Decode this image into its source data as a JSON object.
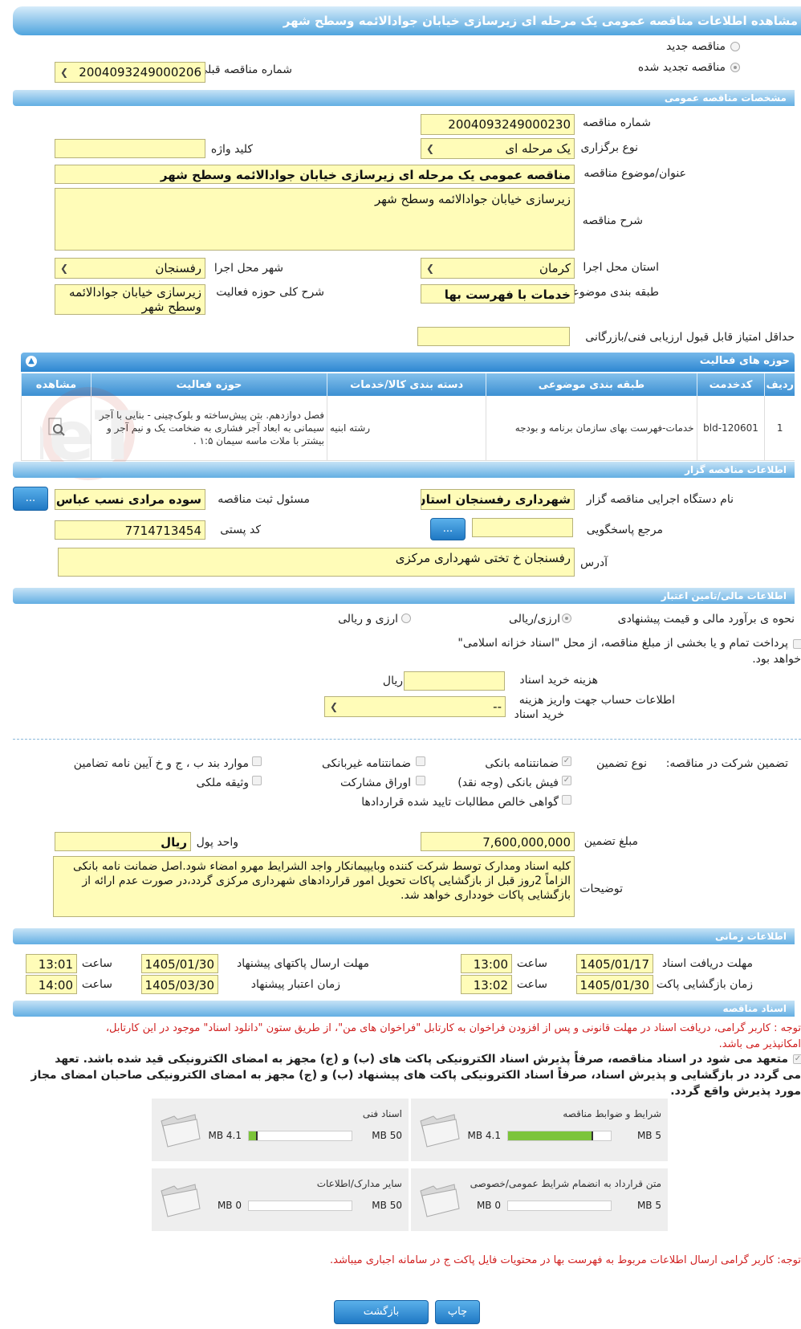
{
  "title": "مشاهده اطلاعات مناقصه عمومی یک مرحله ای زیرسازی خیابان جوادالائمه وسطح شهر",
  "tender_type": {
    "new_label": "مناقصه جدید",
    "renewed_label": "مناقصه تجدید شده",
    "prev_number_label": "شماره مناقصه قبلی",
    "prev_number": "2004093249000206"
  },
  "general": {
    "section_title": "مشخصات مناقصه عمومی",
    "number_label": "شماره مناقصه",
    "number": "2004093249000230",
    "type_label": "نوع برگزاری",
    "type": "یک مرحله ای",
    "keyword_label": "کلید واژه",
    "keyword": "",
    "subject_label": "عنوان/موضوع مناقصه",
    "subject": "مناقصه عمومی یک مرحله ای زیرسازی خیابان جوادالائمه وسطح شهر",
    "desc_label": "شرح مناقصه",
    "desc": "زیرسازی خیابان جوادالائمه وسطح شهر",
    "province_label": "استان محل اجرا",
    "province": "کرمان",
    "city_label": "شهر محل اجرا",
    "city": "رفسنجان",
    "category_label": "طبقه بندی موضوعی",
    "category": "خدمات با فهرست بها",
    "scope_label": "شرح کلی حوزه فعالیت",
    "scope": "زیرسازی خیابان جوادالائمه وسطح شهر",
    "min_score_label": "حداقل امتیاز قابل قبول ارزیابی فنی/بازرگانی",
    "min_score": ""
  },
  "activity": {
    "section_title": "حوزه های فعالیت",
    "headers": [
      "ردیف",
      "کدخدمت",
      "طبقه بندی موضوعی",
      "دسته بندی کالا/خدمات",
      "حوزه فعالیت",
      "مشاهده"
    ],
    "row": {
      "idx": "1",
      "code": "bld-120601",
      "class": "خدمات-فهرست بهای سازمان برنامه و بودجه",
      "group": "رشته ابنیه",
      "scope": "فصل دوازدهم. بتن پیش‌ساخته و بلوک‌چینی - بنایی با آجر سیمانی به ابعاد آجر فشاری به ضخامت یک و نیم آجر و بیشتر با ملات ماسه سیمان ۱:۵ ."
    }
  },
  "organizer": {
    "section_title": "اطلاعات مناقصه گزار",
    "org_label": "نام دستگاه اجرایی مناقصه گزار",
    "org": "شهرداری رفسنجان استان",
    "resp_label": "مسئول ثبت مناقصه",
    "resp": "سوده مرادی نسب عباس آباد",
    "ref_label": "مرجع پاسخگویی",
    "ref": "",
    "zip_label": "کد پستی",
    "zip": "7714713454",
    "addr_label": "آدرس",
    "addr": "رفسنجان خ تختی شهرداری مرکزی",
    "btn_more": "..."
  },
  "finance": {
    "section_title": "اطلاعات مالی/تامین اعتبار",
    "method_label": "نحوه ی برآورد مالی و قیمت پیشنهادی",
    "opt1": "ارزی/ریالی",
    "opt2": "ارزی و ریالی",
    "treasury_line1": "پرداخت تمام و یا بخشی از مبلغ مناقصه، از محل \"اسناد خزانه اسلامی\"",
    "treasury_line2": "خواهد بود.",
    "doc_cost_label": "هزینه خرید اسناد",
    "doc_cost": "",
    "currency": "ریال",
    "account_label1": "اطلاعات حساب جهت واریز هزینه",
    "account_label2": "خرید اسناد",
    "account": "--"
  },
  "guarantee": {
    "title": "تضمین شرکت در مناقصه:",
    "type_label": "نوع تضمین",
    "opts": [
      "ضمانتنامه بانکی",
      "ضمانتنامه غیربانکی",
      "موارد بند ب ، ج و خ آیین نامه تضامین",
      "فیش بانکی (وجه نقد)",
      "اوراق مشارکت",
      "وثیقه ملکی",
      "گواهی خالص مطالبات تایید شده قراردادها"
    ],
    "amount_label": "مبلغ تضمین",
    "amount": "7,600,000,000",
    "unit_label": "واحد پول",
    "unit": "ریال",
    "notes_label": "توضیحات",
    "notes": "کلیه اسناد ومدارک توسط شرکت کننده وبایپیمانکار واجد الشرایط مهرو امضاء شود.اصل ضمانت نامه بانکی الزاماً 2روز قبل از بازگشایی پاکات تحویل امور قراردادهای شهرداری مرکزی گردد،در صورت عدم ارائه از بازگشایی پاکات خودداری خواهد شد."
  },
  "times": {
    "section_title": "اطلاعات زمانی",
    "recv_label": "مهلت دریافت اسناد",
    "recv_date": "1405/01/17",
    "recv_time": "13:00",
    "send_label": "مهلت ارسال پاکتهای پیشنهاد",
    "send_date": "1405/01/30",
    "send_time": "13:01",
    "open_label": "زمان بازگشایی پاکت ها",
    "open_date": "1405/01/30",
    "open_time": "13:02",
    "valid_label": "زمان اعتبار پیشنهاد",
    "valid_date": "1405/03/30",
    "valid_time": "14:00",
    "time_label": "ساعت"
  },
  "docs": {
    "section_title": "اسناد مناقصه",
    "notice_line1": "توجه : کاربر گرامی، دریافت اسناد در مهلت قانونی و پس از افزودن فراخوان به کارتابل \"فراخوان های من\"، از طریق ستون \"دانلود اسناد\" موجود در این کارتابل،",
    "notice_line2": "امکانپذیر می باشد.",
    "commit_line1": "متعهد می شود در اسناد مناقصه، صرفاً پذیرش اسناد الکترونیکی پاکت های (ب) و (ج) مجهز به امضای الکترونیکی قید شده باشد. تعهد",
    "commit_line2": "می گردد در بازگشایی و پذیرش اسناد، صرفاً اسناد الکترونیکی پاکت های پیشنهاد (ب) و (ج) مجهز به امضای الکترونیکی صاحبان امضای مجاز",
    "commit_line3": "مورد پذیرش واقع گردد.",
    "cards": [
      {
        "title": "شرایط و ضوابط مناقصه",
        "max": "5 MB",
        "cur": "4.1 MB",
        "fill": 0.82
      },
      {
        "title": "اسناد فنی",
        "max": "50 MB",
        "cur": "4.1 MB",
        "fill": 0.082
      },
      {
        "title": "متن قرارداد به انضمام شرایط عمومی/خصوصی",
        "max": "5 MB",
        "cur": "0 MB",
        "fill": 0
      },
      {
        "title": "سایر مدارک/اطلاعات",
        "max": "50 MB",
        "cur": "0 MB",
        "fill": 0
      }
    ],
    "bottom_note": "توجه: کاربر گرامی ارسال اطلاعات مربوط به فهرست بها در محتویات فایل پاکت ج در سامانه اجباری میباشد."
  },
  "footer": {
    "print": "چاپ",
    "back": "بازگشت"
  },
  "watermark": "AriaTender.neT",
  "colors": {
    "accent": "#3c8fd2",
    "field": "#fffcb8",
    "red": "#d02020"
  }
}
